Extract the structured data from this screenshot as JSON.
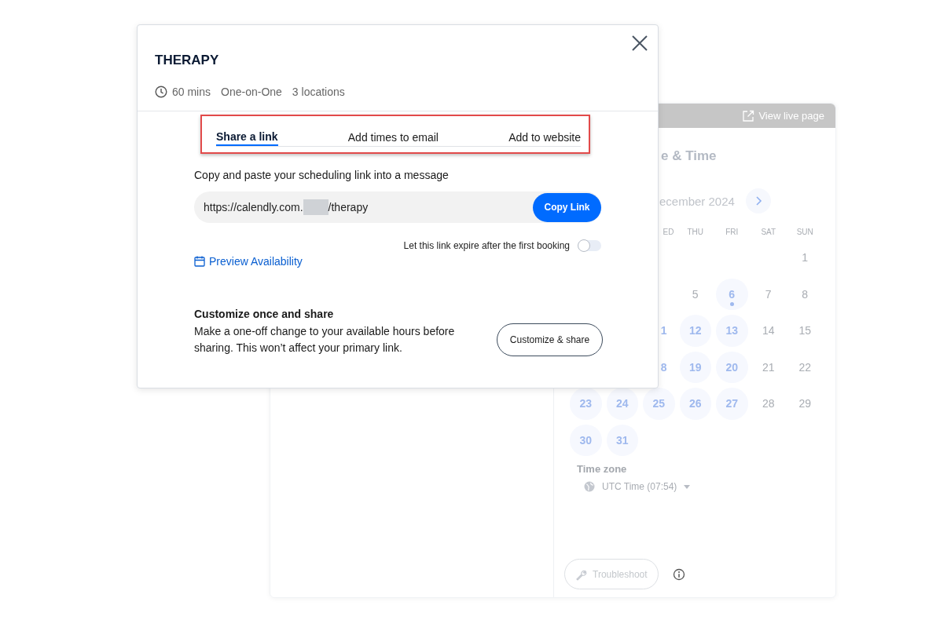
{
  "background": {
    "view_live_page": "View live page",
    "title": "e & Time",
    "month": "ecember 2024",
    "weekdays": [
      "ED",
      "THU",
      "FRI",
      "SAT",
      "SUN"
    ],
    "weeks": [
      [
        {
          "kind": "blank"
        },
        {
          "kind": "blank"
        },
        {
          "kind": "blank"
        },
        {
          "kind": "blank"
        },
        {
          "kind": "blank"
        },
        {
          "kind": "blank"
        },
        {
          "kind": "day",
          "day": "1",
          "available": false,
          "dot": false
        }
      ],
      [
        {
          "kind": "blank"
        },
        {
          "kind": "blank"
        },
        {
          "kind": "blank"
        },
        {
          "kind": "day",
          "day": "5",
          "available": false,
          "dot": false
        },
        {
          "kind": "day",
          "day": "6",
          "available": true,
          "dot": true
        },
        {
          "kind": "day",
          "day": "7",
          "available": false,
          "dot": false
        },
        {
          "kind": "day",
          "day": "8",
          "available": false,
          "dot": false
        }
      ],
      [
        {
          "kind": "blank"
        },
        {
          "kind": "blank"
        },
        {
          "kind": "partial",
          "day": "1",
          "available": true,
          "dot": false
        },
        {
          "kind": "day",
          "day": "12",
          "available": true,
          "dot": false
        },
        {
          "kind": "day",
          "day": "13",
          "available": true,
          "dot": false
        },
        {
          "kind": "day",
          "day": "14",
          "available": false,
          "dot": false
        },
        {
          "kind": "day",
          "day": "15",
          "available": false,
          "dot": false
        }
      ],
      [
        {
          "kind": "blank"
        },
        {
          "kind": "blank"
        },
        {
          "kind": "partial",
          "day": "8",
          "available": true,
          "dot": false
        },
        {
          "kind": "day",
          "day": "19",
          "available": true,
          "dot": false
        },
        {
          "kind": "day",
          "day": "20",
          "available": true,
          "dot": false
        },
        {
          "kind": "day",
          "day": "21",
          "available": false,
          "dot": false
        },
        {
          "kind": "day",
          "day": "22",
          "available": false,
          "dot": false
        }
      ],
      [
        {
          "kind": "day",
          "day": "23",
          "available": true,
          "dot": false
        },
        {
          "kind": "day",
          "day": "24",
          "available": true,
          "dot": false
        },
        {
          "kind": "day",
          "day": "25",
          "available": true,
          "dot": false
        },
        {
          "kind": "day",
          "day": "26",
          "available": true,
          "dot": false
        },
        {
          "kind": "day",
          "day": "27",
          "available": true,
          "dot": false
        },
        {
          "kind": "day",
          "day": "28",
          "available": false,
          "dot": false
        },
        {
          "kind": "day",
          "day": "29",
          "available": false,
          "dot": false
        }
      ],
      [
        {
          "kind": "day",
          "day": "30",
          "available": true,
          "dot": false
        },
        {
          "kind": "day",
          "day": "31",
          "available": true,
          "dot": false
        }
      ]
    ],
    "timezone_label": "Time zone",
    "timezone": "UTC Time (07:54)",
    "troubleshoot": "Troubleshoot"
  },
  "modal": {
    "title": "THERAPY",
    "duration": "60 mins",
    "meeting_type": "One-on-One",
    "locations": "3 locations",
    "tabs": [
      {
        "label": "Share a link",
        "selected": true
      },
      {
        "label": "Add times to email",
        "selected": false
      },
      {
        "label": "Add to website",
        "selected": false
      }
    ],
    "instruction": "Copy and paste your scheduling link into a message",
    "link": {
      "start": "https://calendly.com.",
      "redacted": true,
      "end": "/therapy"
    },
    "copy_button": "Copy Link",
    "expire_toggle": {
      "label": "Let this link expire after the first booking",
      "on": false
    },
    "preview_link": "Preview Availability",
    "customize": {
      "heading": "Customize once and share",
      "description": "Make a one-off change to your available hours before sharing. This won’t affect your primary link.",
      "button": "Customize & share"
    }
  }
}
